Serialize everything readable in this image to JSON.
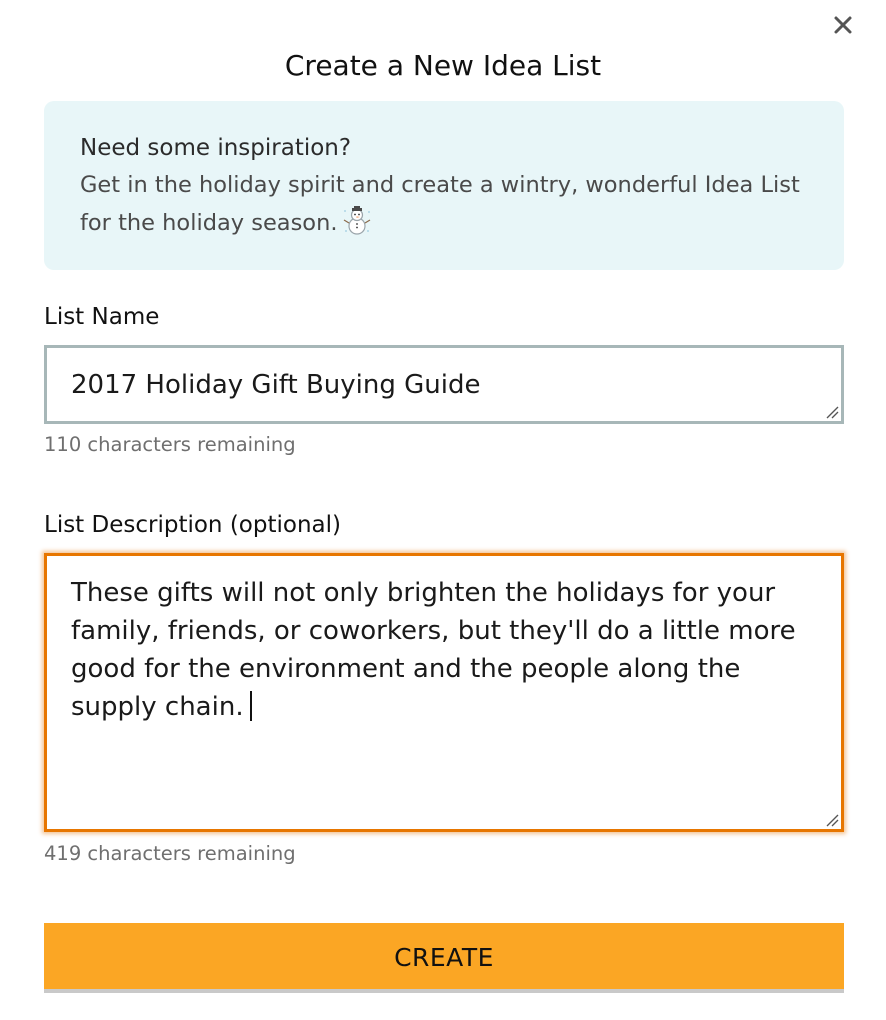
{
  "dialog": {
    "title": "Create a New Idea List",
    "close_icon": "close-icon"
  },
  "inspiration": {
    "heading": "Need some inspiration?",
    "body": "Get in the holiday spirit and create a wintry, wonderful Idea List for the holiday season.",
    "emoji_icon": "snowman-icon",
    "background_color": "#e8f6f8"
  },
  "list_name": {
    "label": "List Name",
    "value": "2017 Holiday Gift Buying Guide",
    "counter": "110 characters remaining"
  },
  "list_description": {
    "label": "List Description (optional)",
    "value": "These gifts will not only brighten the holidays for your family, friends, or coworkers, but they'll do a little more good for the environment and the people along the supply chain.",
    "counter": "419 characters remaining",
    "focused": true,
    "focus_color": "#e77600"
  },
  "actions": {
    "create_label": "CREATE",
    "create_color": "#fba624"
  }
}
